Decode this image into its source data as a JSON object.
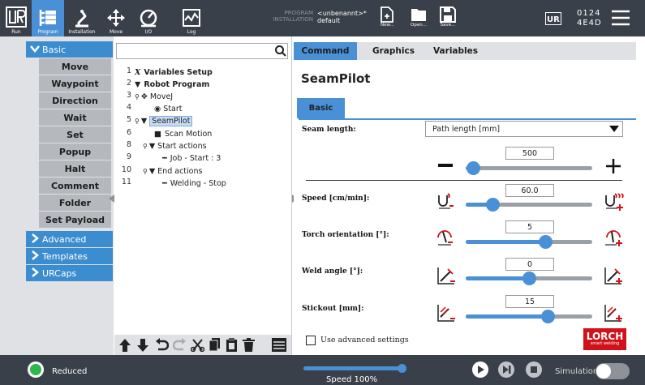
{
  "topbar": {
    "buttons": [
      {
        "label": "Run"
      },
      {
        "label": "Program"
      },
      {
        "label": "Installation"
      },
      {
        "label": "Move"
      },
      {
        "label": "I/O"
      },
      {
        "label": "Log"
      }
    ],
    "program_label": "PROGRAM",
    "program_value": "<unbenannt>*",
    "installation_label": "INSTALLATION",
    "installation_value": "default",
    "new_label": "New...",
    "open_label": "Open...",
    "save_label": "Save...",
    "serial_line1": "0124",
    "serial_line2": "4E4D"
  },
  "leftnav": {
    "basic_label": "Basic",
    "items": [
      "Move",
      "Waypoint",
      "Direction",
      "Wait",
      "Set",
      "Popup",
      "Halt",
      "Comment",
      "Folder",
      "Set Payload"
    ],
    "categories": [
      "Advanced",
      "Templates",
      "URCaps"
    ]
  },
  "tree": {
    "rows": [
      {
        "n": "1",
        "text": "Variables Setup"
      },
      {
        "n": "2",
        "text": "Robot Program"
      },
      {
        "n": "3",
        "text": "MoveJ"
      },
      {
        "n": "4",
        "text": "Start"
      },
      {
        "n": "5",
        "text": "SeamPilot"
      },
      {
        "n": "6",
        "text": "Scan Motion"
      },
      {
        "n": "8",
        "text": "Start actions"
      },
      {
        "n": "9",
        "text": "Job - Start : 3"
      },
      {
        "n": "10",
        "text": "End actions"
      },
      {
        "n": "11",
        "text": "Welding - Stop"
      }
    ]
  },
  "tabs": [
    "Command",
    "Graphics",
    "Variables"
  ],
  "panel": {
    "title": "SeamPilot",
    "subtab": "Basic",
    "seam_length_label": "Seam length:",
    "seam_length_select": "Path length [mm]",
    "seam_value": "500",
    "seam_fraction": 0.06,
    "speed_label": "Speed [cm/min]:",
    "speed_value": "60.0",
    "speed_fraction": 0.21,
    "torch_label": "Torch orientation [°]:",
    "torch_value": "5",
    "torch_fraction": 0.63,
    "weld_label": "Weld angle [°]:",
    "weld_value": "0",
    "weld_fraction": 0.5,
    "stickout_label": "Stickout [mm]:",
    "stickout_value": "15",
    "stickout_fraction": 0.65,
    "advanced_label": "Use advanced settings",
    "lorch_logo": "LORCH",
    "lorch_tagline": "smart welding"
  },
  "bottombar": {
    "status": "Reduced",
    "speed_label": "Speed 100%",
    "speed_fraction": 1.0,
    "simulation_label": "Simulation"
  },
  "colors": {
    "accent": "#4a90d6",
    "topbar": "#3a4049",
    "status_green": "#2db84b",
    "lorch_red": "#d0121b"
  }
}
